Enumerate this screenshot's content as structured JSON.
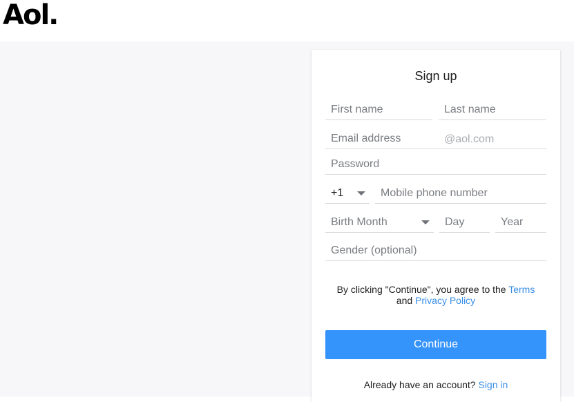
{
  "logo": {
    "text": "Aol."
  },
  "form": {
    "title": "Sign up",
    "first_name_placeholder": "First name",
    "last_name_placeholder": "Last name",
    "email_placeholder": "Email address",
    "email_suffix": "@aol.com",
    "password_placeholder": "Password",
    "country_code": "+1",
    "phone_placeholder": "Mobile phone number",
    "birth_month_placeholder": "Birth Month",
    "day_placeholder": "Day",
    "year_placeholder": "Year",
    "gender_placeholder": "Gender (optional)"
  },
  "legal": {
    "prefix": "By clicking \"Continue\", you agree to the ",
    "terms_link": "Terms",
    "and_text": "and ",
    "privacy_link": "Privacy Policy"
  },
  "continue_label": "Continue",
  "signin": {
    "prompt": "Already have an account? ",
    "link": "Sign in"
  },
  "colors": {
    "accent": "#3593fc",
    "link": "#3a8ee6",
    "background": "#f7f7f9"
  },
  "icons": {
    "dropdown": "chevron-down-icon"
  }
}
